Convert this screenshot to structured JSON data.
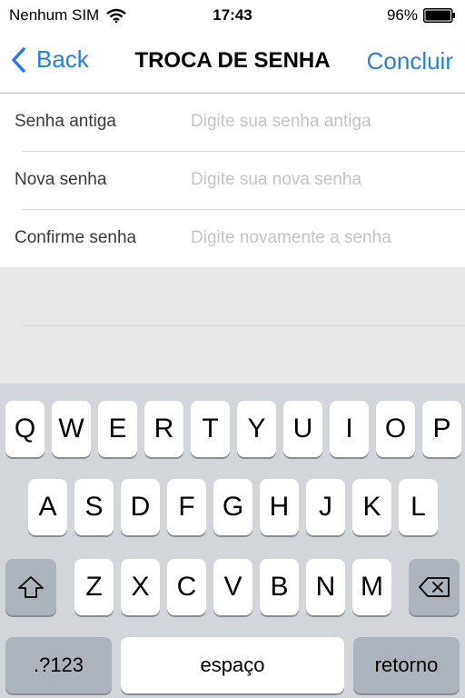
{
  "status_bar": {
    "carrier": "Nenhum SIM",
    "time": "17:43",
    "battery": "96%"
  },
  "nav": {
    "back_label": "Back",
    "title": "TROCA DE SENHA",
    "done_label": "Concluir"
  },
  "form": {
    "rows": [
      {
        "label": "Senha antiga",
        "placeholder": "Digite sua senha antiga",
        "value": ""
      },
      {
        "label": "Nova senha",
        "placeholder": "Digite sua nova senha",
        "value": ""
      },
      {
        "label": "Confirme senha",
        "placeholder": "Digite novamente a senha",
        "value": ""
      }
    ]
  },
  "keyboard": {
    "row1": [
      "Q",
      "W",
      "E",
      "R",
      "T",
      "Y",
      "U",
      "I",
      "O",
      "P"
    ],
    "row2": [
      "A",
      "S",
      "D",
      "F",
      "G",
      "H",
      "J",
      "K",
      "L"
    ],
    "row3": [
      "Z",
      "X",
      "C",
      "V",
      "B",
      "N",
      "M"
    ],
    "numbers_label": ".?123",
    "space_label": "espaço",
    "return_label": "retorno"
  },
  "colors": {
    "accent": "#1e7ff0",
    "keyboard_bg": "#d2d5da",
    "special_key": "#adb3bc"
  }
}
